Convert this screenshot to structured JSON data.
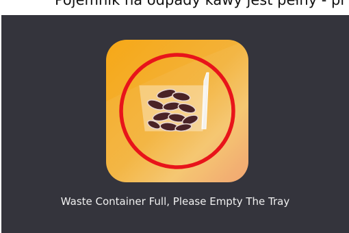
{
  "header": {
    "caption": "Pojemnik na odpady kawy jest pełny - pr"
  },
  "alert": {
    "icon": "full-waste-bin-icon",
    "message": "Waste Container Full, Please Empty The Tray",
    "accent_color": "#f4a91a",
    "ring_color": "#e8141a",
    "background_color": "#34343c"
  }
}
